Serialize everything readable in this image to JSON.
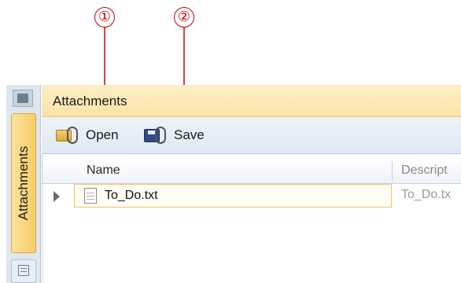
{
  "callouts": {
    "first": "①",
    "second": "②"
  },
  "side_tabs": {
    "attachments_label": "Attachments"
  },
  "panel": {
    "title": "Attachments",
    "toolbar": {
      "open_label": "Open",
      "save_label": "Save"
    },
    "grid": {
      "columns": [
        "Name",
        "Descript"
      ],
      "rows": [
        {
          "name": "To_Do.txt",
          "description": "To_Do.tx"
        }
      ]
    }
  },
  "colors": {
    "callout": "#cc0000",
    "accent_tab": "#f6cd68",
    "title_bar": "#fbe3a8"
  }
}
